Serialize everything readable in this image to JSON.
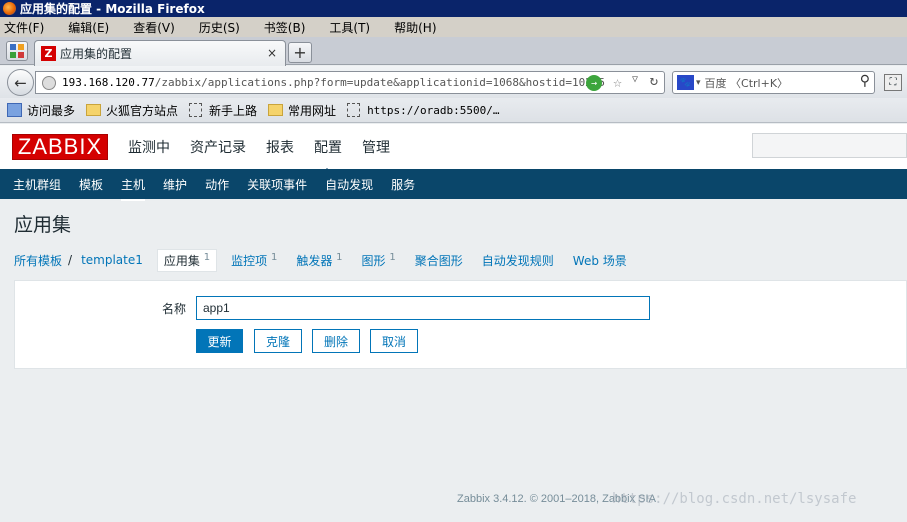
{
  "window": {
    "title": "应用集的配置 - Mozilla Firefox"
  },
  "menubar": [
    "文件(F)",
    "编辑(E)",
    "查看(V)",
    "历史(S)",
    "书签(B)",
    "工具(T)",
    "帮助(H)"
  ],
  "tab": {
    "title": "应用集的配置",
    "close": "×",
    "new_tab": "+"
  },
  "urlbar": {
    "host": "193.168.120.77",
    "path": "/zabbix/applications.php?form=update&applicationid=1068&hostid=10255"
  },
  "searchbar": {
    "placeholder": "百度 〈Ctrl+K〉"
  },
  "bookmarks": [
    "访问最多",
    "火狐官方站点",
    "新手上路",
    "常用网址",
    "https://oradb:5500/…"
  ],
  "zabbix": {
    "logo": "ZABBIX",
    "topnav": [
      "监测中",
      "资产记录",
      "报表",
      "配置",
      "管理"
    ],
    "subnav": [
      "主机群组",
      "模板",
      "主机",
      "维护",
      "动作",
      "关联项事件",
      "自动发现",
      "服务"
    ],
    "page_title": "应用集",
    "breadcrumbs": {
      "all_templates": "所有模板",
      "separator": "/",
      "template": "template1",
      "applications": "应用集",
      "applications_count": "1",
      "items": "监控项",
      "items_count": "1",
      "triggers": "触发器",
      "triggers_count": "1",
      "graphs": "图形",
      "graphs_count": "1",
      "screens": "聚合图形",
      "discovery": "自动发现规则",
      "web": "Web 场景"
    },
    "form": {
      "name_label": "名称",
      "name_value": "app1"
    },
    "buttons": {
      "update": "更新",
      "clone": "克隆",
      "delete": "删除",
      "cancel": "取消"
    },
    "footer": "Zabbix 3.4.12. © 2001–2018, Zabbix SIA"
  },
  "watermark": "https://blog.csdn.net/lsysafe",
  "colors": {
    "brand_red": "#d40000",
    "nav_blue": "#0a466a",
    "link_blue": "#0275b8"
  }
}
